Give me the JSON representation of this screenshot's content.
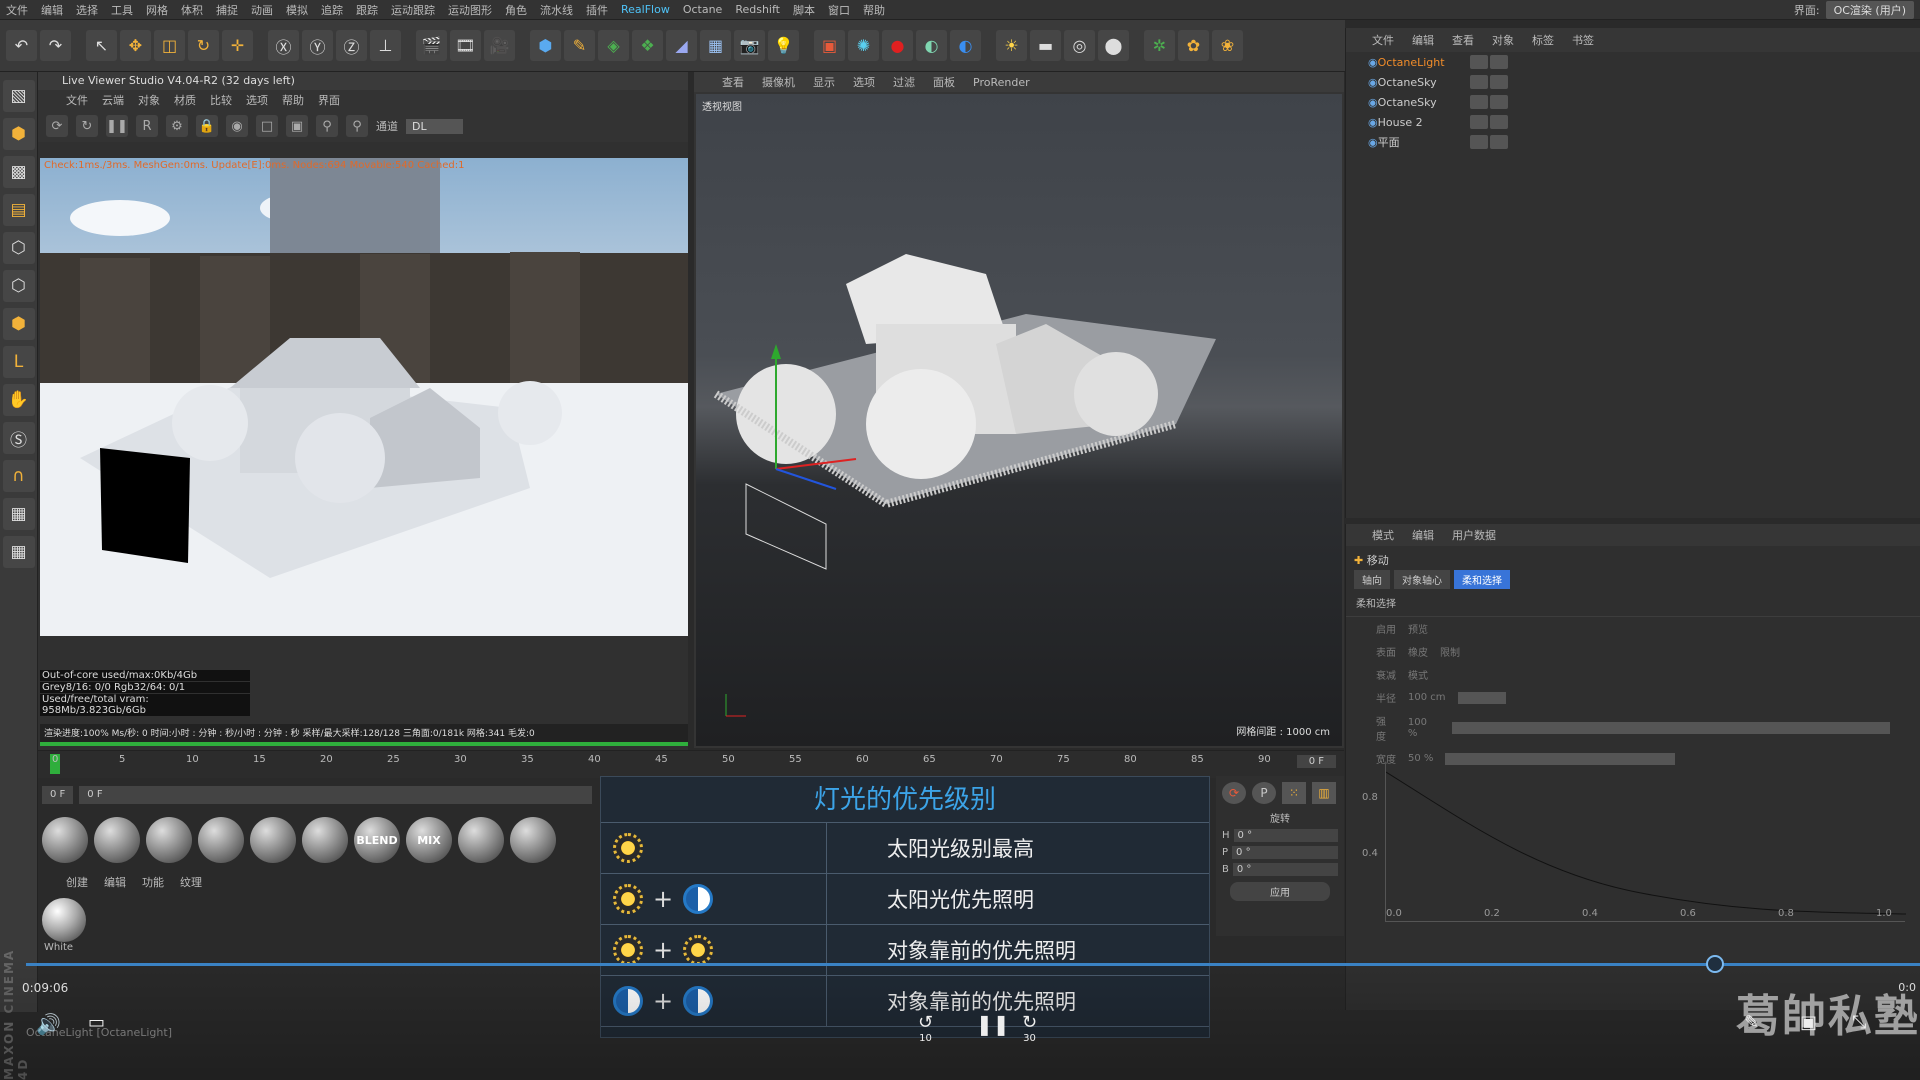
{
  "menubar": {
    "items": [
      "文件",
      "编辑",
      "选择",
      "工具",
      "网格",
      "体积",
      "捕捉",
      "动画",
      "模拟",
      "追踪",
      "跟踪",
      "运动跟踪",
      "运动图形",
      "角色",
      "流水线",
      "插件",
      "RealFlow",
      "Octane",
      "Redshift",
      "脚本",
      "窗口",
      "帮助"
    ],
    "interface_label": "界面:",
    "interface_value": "OC渲染 (用户)"
  },
  "live_viewer": {
    "title": "Live Viewer Studio V4.04-R2 (32 days left)",
    "menu": [
      "文件",
      "云端",
      "对象",
      "材质",
      "比较",
      "选项",
      "帮助",
      "界面"
    ],
    "channel_label": "通道",
    "channel_value": "DL",
    "check_line": "Check:1ms./3ms. MeshGen:0ms. Update[E]:0ms. Nodes:694 Movable:540 Cached:1",
    "stats": [
      "Out-of-core used/max:0Kb/4Gb",
      "Grey8/16: 0/0     Rgb32/64: 0/1",
      "Used/free/total vram: 958Mb/3.823Gb/6Gb"
    ],
    "progress": "渲染进度:100%    Ms/秒: 0    时间:小时 : 分钟 : 秒/小时 : 分钟 : 秒    采样/最大采样:128/128    三角面:0/181k    网格:341    毛发:0"
  },
  "viewport": {
    "menu": [
      "查看",
      "摄像机",
      "显示",
      "选项",
      "过滤",
      "面板",
      "ProRender"
    ],
    "label": "透视视图",
    "grid_info": "网格间距 : 1000 cm"
  },
  "timeline": {
    "ticks": [
      "0",
      "5",
      "10",
      "15",
      "20",
      "25",
      "30",
      "35",
      "40",
      "45",
      "50",
      "55",
      "60",
      "65",
      "70",
      "75",
      "80",
      "85",
      "90"
    ],
    "frame_right": "0 F",
    "frame_a": "0 F",
    "frame_b": "0 F"
  },
  "materials": {
    "menu": [
      "创建",
      "编辑",
      "功能",
      "纹理"
    ],
    "balls": [
      "",
      "",
      "",
      "",
      "",
      "",
      "BLEND",
      "MIX",
      "",
      ""
    ],
    "white_label": "White"
  },
  "priority": {
    "title": "灯光的优先级别",
    "rows": [
      {
        "icons": [
          "sun"
        ],
        "text": "太阳光级别最高"
      },
      {
        "icons": [
          "sun",
          "half"
        ],
        "text": "太阳光优先照明"
      },
      {
        "icons": [
          "sun",
          "sun"
        ],
        "text": "对象靠前的优先照明"
      },
      {
        "icons": [
          "half",
          "half"
        ],
        "text": "对象靠前的优先照明"
      }
    ]
  },
  "coords": {
    "title": "旋转",
    "rows": [
      {
        "axis": "H",
        "value": "0 °"
      },
      {
        "axis": "P",
        "value": "0 °"
      },
      {
        "axis": "B",
        "value": "0 °"
      }
    ],
    "apply": "应用"
  },
  "objects": {
    "menu": [
      "文件",
      "编辑",
      "查看",
      "对象",
      "标签",
      "书签"
    ],
    "items": [
      {
        "name": "OctaneLight",
        "selected": true
      },
      {
        "name": "OctaneSky",
        "selected": false
      },
      {
        "name": "OctaneSky",
        "selected": false
      },
      {
        "name": "House 2",
        "selected": false
      },
      {
        "name": "平面",
        "selected": false
      }
    ]
  },
  "attributes": {
    "menu": [
      "模式",
      "编辑",
      "用户数据"
    ],
    "move_label": "移动",
    "tabs": [
      "轴向",
      "对象轴心",
      "柔和选择"
    ],
    "section": "柔和选择",
    "rows": [
      [
        "启用",
        "预览"
      ],
      [
        "表面",
        "橡皮",
        "限制"
      ],
      [
        "衰减",
        "模式"
      ],
      [
        "半径",
        "100 cm"
      ],
      [
        "强度",
        "100 %"
      ],
      [
        "宽度",
        "50 %"
      ]
    ],
    "graph_y": [
      "0.8",
      "0.4"
    ],
    "graph_x": [
      "0.0",
      "0.2",
      "0.4",
      "0.6",
      "0.8",
      "1.0"
    ]
  },
  "player": {
    "time": "0:09:06",
    "end_time": "0:0",
    "rewind": "10",
    "forward": "30"
  },
  "status": {
    "text": "OctaneLight [OctaneLight]"
  },
  "watermark": "葛帥私塾",
  "colors": {
    "accent": "#3ca4e8",
    "selected": "#f08c2a",
    "progress": "#2fae3c"
  }
}
